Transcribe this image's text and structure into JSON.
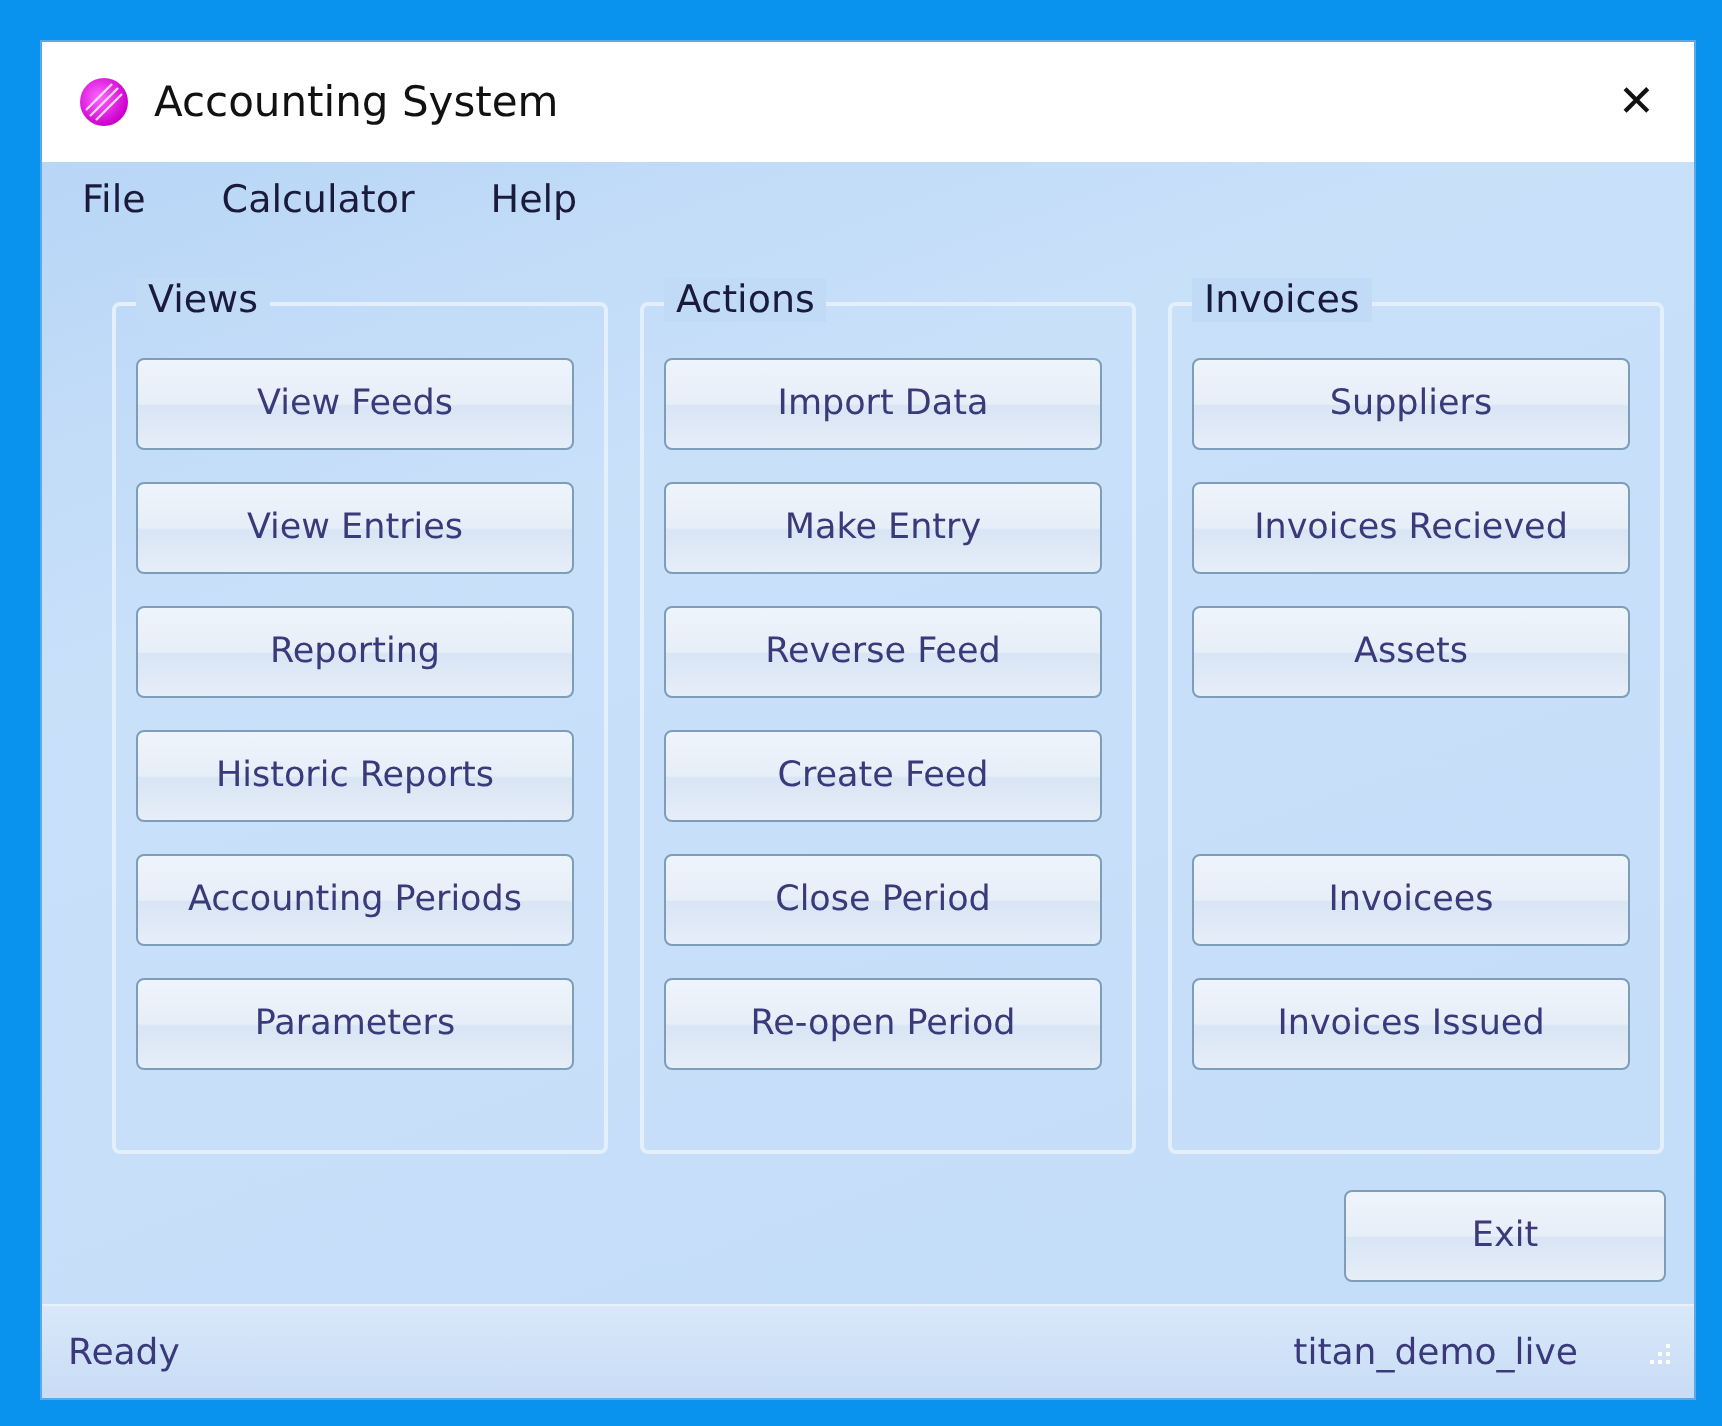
{
  "window": {
    "title": "Accounting System",
    "close": "✕"
  },
  "menu": [
    "File",
    "Calculator",
    "Help"
  ],
  "groups": [
    {
      "title": "Views",
      "buttons": [
        "View Feeds",
        "View Entries",
        "Reporting",
        "Historic Reports",
        "Accounting Periods",
        "Parameters"
      ]
    },
    {
      "title": "Actions",
      "buttons": [
        "Import Data",
        "Make Entry",
        "Reverse Feed",
        "Create Feed",
        "Close Period",
        "Re-open Period"
      ]
    },
    {
      "title": "Invoices",
      "buttons": [
        "Suppliers",
        "Invoices Recieved",
        "Assets"
      ],
      "bottom_buttons": [
        "Invoicees",
        "Invoices Issued"
      ]
    }
  ],
  "exit_button": "Exit",
  "status_bar": {
    "status": "Ready",
    "database": "titan_demo_live"
  }
}
